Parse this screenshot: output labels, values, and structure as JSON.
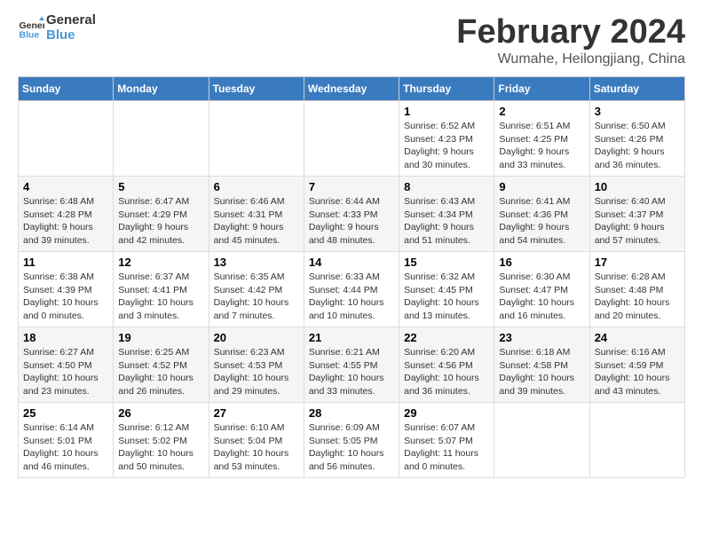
{
  "header": {
    "logo_line1": "General",
    "logo_line2": "Blue",
    "main_title": "February 2024",
    "sub_title": "Wumahe, Heilongjiang, China"
  },
  "days_of_week": [
    "Sunday",
    "Monday",
    "Tuesday",
    "Wednesday",
    "Thursday",
    "Friday",
    "Saturday"
  ],
  "weeks": [
    [
      {
        "day": "",
        "info": ""
      },
      {
        "day": "",
        "info": ""
      },
      {
        "day": "",
        "info": ""
      },
      {
        "day": "",
        "info": ""
      },
      {
        "day": "1",
        "info": "Sunrise: 6:52 AM\nSunset: 4:23 PM\nDaylight: 9 hours\nand 30 minutes."
      },
      {
        "day": "2",
        "info": "Sunrise: 6:51 AM\nSunset: 4:25 PM\nDaylight: 9 hours\nand 33 minutes."
      },
      {
        "day": "3",
        "info": "Sunrise: 6:50 AM\nSunset: 4:26 PM\nDaylight: 9 hours\nand 36 minutes."
      }
    ],
    [
      {
        "day": "4",
        "info": "Sunrise: 6:48 AM\nSunset: 4:28 PM\nDaylight: 9 hours\nand 39 minutes."
      },
      {
        "day": "5",
        "info": "Sunrise: 6:47 AM\nSunset: 4:29 PM\nDaylight: 9 hours\nand 42 minutes."
      },
      {
        "day": "6",
        "info": "Sunrise: 6:46 AM\nSunset: 4:31 PM\nDaylight: 9 hours\nand 45 minutes."
      },
      {
        "day": "7",
        "info": "Sunrise: 6:44 AM\nSunset: 4:33 PM\nDaylight: 9 hours\nand 48 minutes."
      },
      {
        "day": "8",
        "info": "Sunrise: 6:43 AM\nSunset: 4:34 PM\nDaylight: 9 hours\nand 51 minutes."
      },
      {
        "day": "9",
        "info": "Sunrise: 6:41 AM\nSunset: 4:36 PM\nDaylight: 9 hours\nand 54 minutes."
      },
      {
        "day": "10",
        "info": "Sunrise: 6:40 AM\nSunset: 4:37 PM\nDaylight: 9 hours\nand 57 minutes."
      }
    ],
    [
      {
        "day": "11",
        "info": "Sunrise: 6:38 AM\nSunset: 4:39 PM\nDaylight: 10 hours\nand 0 minutes."
      },
      {
        "day": "12",
        "info": "Sunrise: 6:37 AM\nSunset: 4:41 PM\nDaylight: 10 hours\nand 3 minutes."
      },
      {
        "day": "13",
        "info": "Sunrise: 6:35 AM\nSunset: 4:42 PM\nDaylight: 10 hours\nand 7 minutes."
      },
      {
        "day": "14",
        "info": "Sunrise: 6:33 AM\nSunset: 4:44 PM\nDaylight: 10 hours\nand 10 minutes."
      },
      {
        "day": "15",
        "info": "Sunrise: 6:32 AM\nSunset: 4:45 PM\nDaylight: 10 hours\nand 13 minutes."
      },
      {
        "day": "16",
        "info": "Sunrise: 6:30 AM\nSunset: 4:47 PM\nDaylight: 10 hours\nand 16 minutes."
      },
      {
        "day": "17",
        "info": "Sunrise: 6:28 AM\nSunset: 4:48 PM\nDaylight: 10 hours\nand 20 minutes."
      }
    ],
    [
      {
        "day": "18",
        "info": "Sunrise: 6:27 AM\nSunset: 4:50 PM\nDaylight: 10 hours\nand 23 minutes."
      },
      {
        "day": "19",
        "info": "Sunrise: 6:25 AM\nSunset: 4:52 PM\nDaylight: 10 hours\nand 26 minutes."
      },
      {
        "day": "20",
        "info": "Sunrise: 6:23 AM\nSunset: 4:53 PM\nDaylight: 10 hours\nand 29 minutes."
      },
      {
        "day": "21",
        "info": "Sunrise: 6:21 AM\nSunset: 4:55 PM\nDaylight: 10 hours\nand 33 minutes."
      },
      {
        "day": "22",
        "info": "Sunrise: 6:20 AM\nSunset: 4:56 PM\nDaylight: 10 hours\nand 36 minutes."
      },
      {
        "day": "23",
        "info": "Sunrise: 6:18 AM\nSunset: 4:58 PM\nDaylight: 10 hours\nand 39 minutes."
      },
      {
        "day": "24",
        "info": "Sunrise: 6:16 AM\nSunset: 4:59 PM\nDaylight: 10 hours\nand 43 minutes."
      }
    ],
    [
      {
        "day": "25",
        "info": "Sunrise: 6:14 AM\nSunset: 5:01 PM\nDaylight: 10 hours\nand 46 minutes."
      },
      {
        "day": "26",
        "info": "Sunrise: 6:12 AM\nSunset: 5:02 PM\nDaylight: 10 hours\nand 50 minutes."
      },
      {
        "day": "27",
        "info": "Sunrise: 6:10 AM\nSunset: 5:04 PM\nDaylight: 10 hours\nand 53 minutes."
      },
      {
        "day": "28",
        "info": "Sunrise: 6:09 AM\nSunset: 5:05 PM\nDaylight: 10 hours\nand 56 minutes."
      },
      {
        "day": "29",
        "info": "Sunrise: 6:07 AM\nSunset: 5:07 PM\nDaylight: 11 hours\nand 0 minutes."
      },
      {
        "day": "",
        "info": ""
      },
      {
        "day": "",
        "info": ""
      }
    ]
  ]
}
